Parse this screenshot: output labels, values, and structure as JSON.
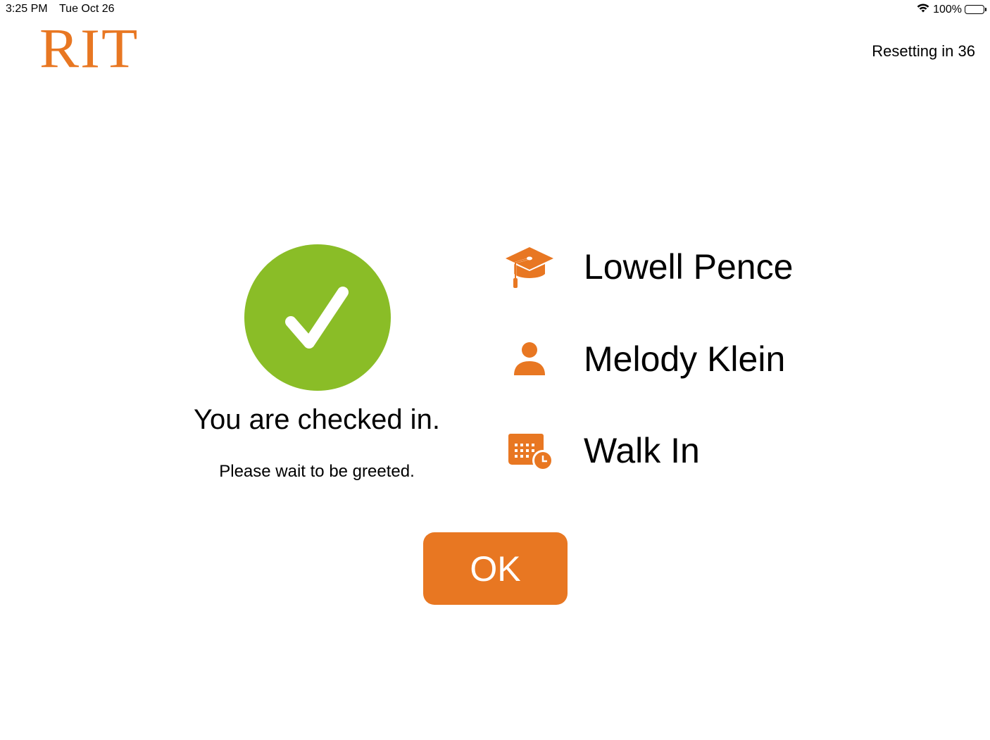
{
  "status_bar": {
    "time": "3:25 PM",
    "date": "Tue Oct 26",
    "battery_percent": "100%",
    "wifi_icon": "wifi-icon",
    "battery_icon": "battery-icon"
  },
  "header": {
    "logo_text": "RIT",
    "reset_text": "Resetting in 36"
  },
  "confirmation": {
    "icon": "checkmark-icon",
    "title": "You are checked in.",
    "subtitle": "Please wait to be greeted."
  },
  "details": [
    {
      "icon": "graduation-cap-icon",
      "label": "Lowell Pence"
    },
    {
      "icon": "person-icon",
      "label": "Melody Klein"
    },
    {
      "icon": "calendar-clock-icon",
      "label": "Walk In"
    }
  ],
  "actions": {
    "ok_label": "OK"
  },
  "colors": {
    "accent": "#e87722",
    "success": "#8abd27"
  }
}
